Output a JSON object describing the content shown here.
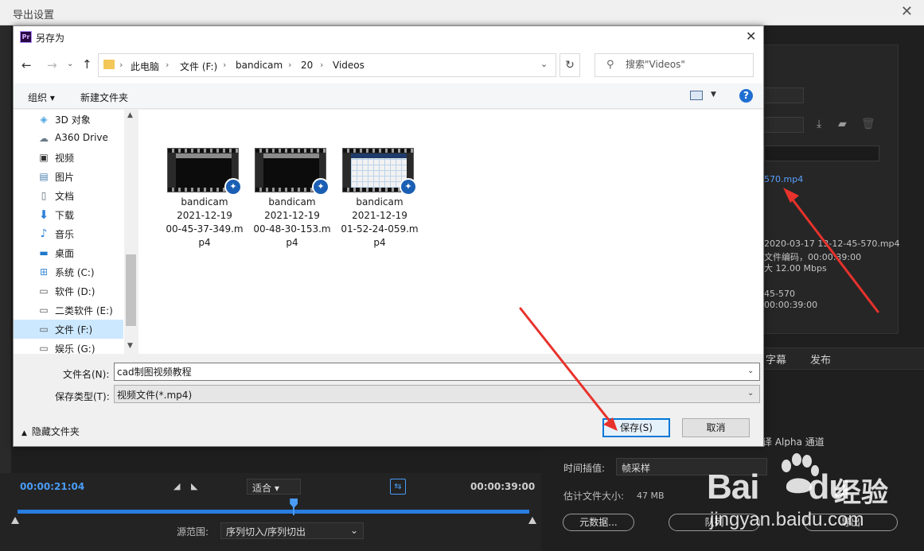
{
  "export_window": {
    "title": "导出设置",
    "close_glyph": "✕",
    "output_name_link": "570.mp4",
    "summary_lines": [
      "2020-03-17 13-12-45-570.mp4",
      "文件编码，00:00:39:00",
      "大 12.00 Mbps",
      "45-570",
      "00:00:39:00"
    ],
    "tabs": [
      "字幕",
      "发布"
    ],
    "alpha_label": "译 Alpha 通道",
    "time_interpolation_label": "时间插值:",
    "time_interpolation_value": "帧采样",
    "estimated_size_label": "估计文件大小:",
    "estimated_size_value": "47 MB",
    "metadata_button": "元数据...",
    "queue_button": "队列",
    "export_button": "导出"
  },
  "timeline": {
    "timecode_start": "00:00:21:04",
    "timecode_end": "00:00:39:00",
    "fit_value": "适合",
    "source_range_label": "源范围:",
    "source_range_value": "序列切入/序列切出",
    "playhead_fraction": 0.54
  },
  "dialog": {
    "app_badge": "Pr",
    "title": "另存为",
    "close_glyph": "✕",
    "address": {
      "crumbs": [
        "此电脑",
        "文件 (F:)",
        "bandicam",
        "20",
        "Videos"
      ]
    },
    "search": {
      "placeholder": "搜索\"Videos\""
    },
    "toolbar": {
      "organize": "组织 ▾",
      "new_folder": "新建文件夹",
      "help": "?"
    },
    "nav_items": [
      {
        "label": "3D 对象",
        "icon": "cube-icon"
      },
      {
        "label": "A360 Drive",
        "icon": "cloud-drive-icon"
      },
      {
        "label": "视频",
        "icon": "video-icon"
      },
      {
        "label": "图片",
        "icon": "picture-icon"
      },
      {
        "label": "文档",
        "icon": "document-icon"
      },
      {
        "label": "下载",
        "icon": "download-icon"
      },
      {
        "label": "音乐",
        "icon": "music-icon"
      },
      {
        "label": "桌面",
        "icon": "desktop-icon"
      },
      {
        "label": "系统 (C:)",
        "icon": "drive-c-icon"
      },
      {
        "label": "软件 (D:)",
        "icon": "drive-icon"
      },
      {
        "label": "二类软件 (E:)",
        "icon": "drive-icon"
      },
      {
        "label": "文件 (F:)",
        "icon": "drive-icon",
        "selected": true
      },
      {
        "label": "娱乐 (G:)",
        "icon": "drive-icon"
      }
    ],
    "files": [
      {
        "name": "bandicam\n2021-12-19\n00-45-37-349.m\np4",
        "thumb": "dark"
      },
      {
        "name": "bandicam\n2021-12-19\n00-48-30-153.m\np4",
        "thumb": "dark"
      },
      {
        "name": "bandicam\n2021-12-19\n01-52-24-059.m\np4",
        "thumb": "light"
      }
    ],
    "filename_label": "文件名(N):",
    "filename_value": "cad制图视频教程",
    "filetype_label": "保存类型(T):",
    "filetype_value": "视频文件(*.mp4)",
    "hide_folders": "隐藏文件夹",
    "save_button": "保存(S)",
    "cancel_button": "取消"
  },
  "watermark": {
    "brand": "Bai",
    "brand_du": "du",
    "jingyan": "经验",
    "url": "jingyan.baidu.com"
  },
  "colors": {
    "accent_blue": "#0078d7",
    "annotation_red": "#e8322c",
    "premiere_blue": "#4a9cf5"
  }
}
